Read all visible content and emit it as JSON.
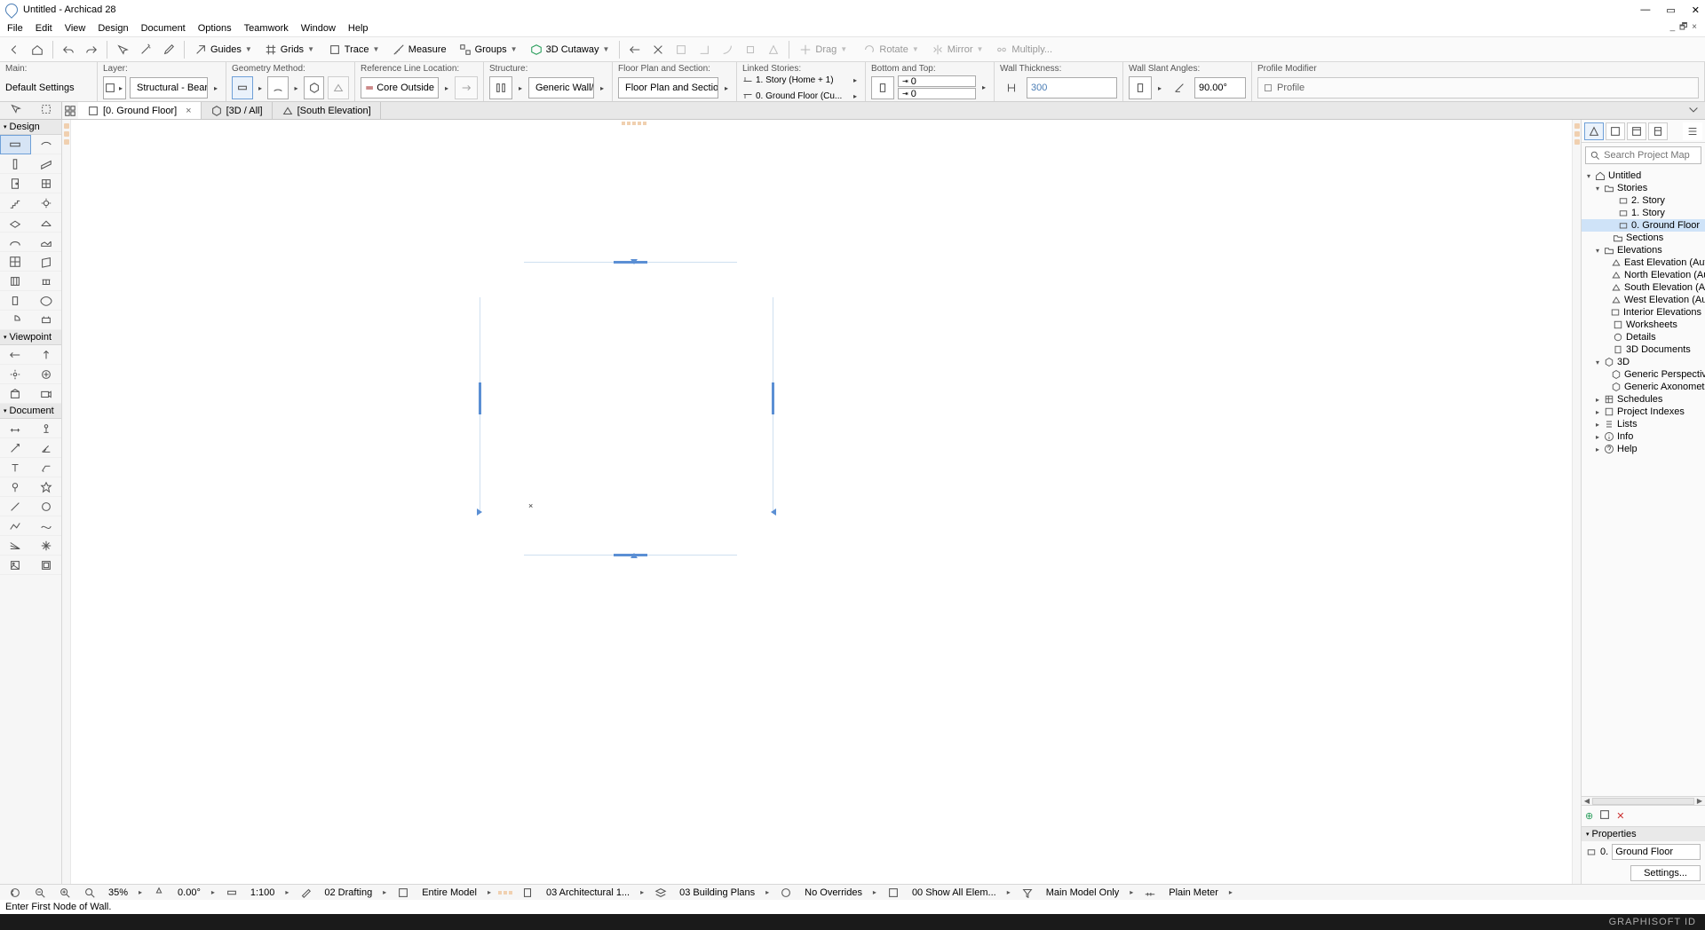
{
  "window": {
    "title": "Untitled - Archicad 28"
  },
  "menu": [
    "File",
    "Edit",
    "View",
    "Design",
    "Document",
    "Options",
    "Teamwork",
    "Window",
    "Help"
  ],
  "menu_sub": "_ 🗗 ×",
  "toolbar": {
    "groups": [
      "Guides",
      "Grids",
      "Trace",
      "Measure",
      "Groups",
      "3D Cutaway"
    ],
    "right": [
      "Drag",
      "Rotate",
      "Mirror",
      "Multiply..."
    ]
  },
  "options": {
    "main": {
      "label": "Main:",
      "value": "Default Settings"
    },
    "layer": {
      "label": "Layer:",
      "value": "Structural - Bearing"
    },
    "geom": {
      "label": "Geometry Method:"
    },
    "refline": {
      "label": "Reference Line Location:",
      "value": "Core Outside"
    },
    "structure": {
      "label": "Structure:",
      "value": "Generic Wall/S..."
    },
    "floorplan": {
      "label": "Floor Plan and Section:",
      "value": "Floor Plan and Section..."
    },
    "linked": {
      "label": "Linked Stories:",
      "top": "1. Story (Home + 1)",
      "bot": "0. Ground Floor (Cu..."
    },
    "bottop": {
      "label": "Bottom and Top:",
      "top": "0",
      "bot": "0"
    },
    "thickness": {
      "label": "Wall Thickness:",
      "value": "300"
    },
    "slant": {
      "label": "Wall Slant Angles:",
      "value": "90.00°"
    },
    "profile": {
      "label": "Profile Modifier",
      "value": "Profile"
    }
  },
  "tabs": {
    "a": "[0. Ground Floor]",
    "b": "[3D / All]",
    "c": "[South Elevation]"
  },
  "left": {
    "design": "Design",
    "viewpoint": "Viewpoint",
    "document": "Document"
  },
  "navigator": {
    "search_ph": "Search Project Map",
    "root": "Untitled",
    "stories": "Stories",
    "story2": "2. Story",
    "story1": "1. Story",
    "story0": "0. Ground Floor",
    "sections": "Sections",
    "elevations": "Elevations",
    "elev_e": "East Elevation (Auto-re",
    "elev_n": "North Elevation (Auto-",
    "elev_s": "South Elevation (Auto-",
    "elev_w": "West Elevation (Auto-r",
    "intelev": "Interior Elevations",
    "worksheets": "Worksheets",
    "details": "Details",
    "doc3d": "3D Documents",
    "three_d": "3D",
    "persp": "Generic Perspective",
    "axo": "Generic Axonometry",
    "schedules": "Schedules",
    "projidx": "Project Indexes",
    "lists": "Lists",
    "info": "Info",
    "help": "Help"
  },
  "properties": {
    "title": "Properties",
    "id_lbl": "0.",
    "id_val": "Ground Floor",
    "settings": "Settings..."
  },
  "status_strip": {
    "zoom": "35%",
    "angle": "0.00°",
    "scale": "1:100",
    "pen": "02 Drafting",
    "model": "Entire Model",
    "arch": "03 Architectural 1...",
    "plans": "03 Building Plans",
    "over": "No Overrides",
    "show": "00 Show All Elem...",
    "main": "Main Model Only",
    "unit": "Plain Meter"
  },
  "status": "Enter First Node of Wall.",
  "brand": "GRAPHISOFT ID"
}
